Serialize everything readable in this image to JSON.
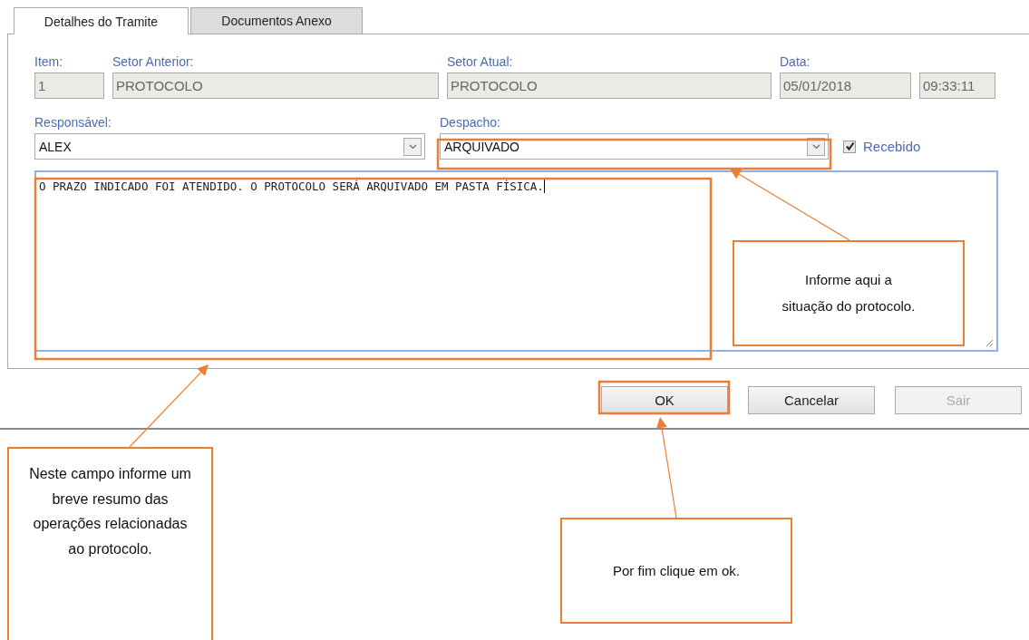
{
  "tabs": [
    {
      "label": "Detalhes do Tramite",
      "selected": true
    },
    {
      "label": "Documentos Anexo",
      "selected": false
    }
  ],
  "info_fields": [
    {
      "label": "Item:",
      "value": "1",
      "disabled": true
    },
    {
      "label": "Setor Anterior:",
      "value": "PROTOCOLO",
      "disabled": true
    },
    {
      "label": "Setor Atual:",
      "value": "PROTOCOLO",
      "disabled": true
    },
    {
      "label": "Data:",
      "value": "05/01/2018",
      "disabled": true
    },
    {
      "value": "09:33:11",
      "disabled": true
    }
  ],
  "responsavel": {
    "label": "Responsável:",
    "value": "ALEX"
  },
  "despacho": {
    "label": "Despacho:",
    "value": "ARQUIVADO"
  },
  "recebido": {
    "label": "Recebido",
    "checked": true
  },
  "resumo": {
    "value": "O PRAZO INDICADO FOI ATENDIDO. O PROTOCOLO SERÁ ARQUIVADO EM PASTA FÍSICA."
  },
  "buttons": [
    {
      "label": "OK",
      "disabled": false
    },
    {
      "label": "Cancelar",
      "disabled": false
    },
    {
      "label": "Sair",
      "disabled": true
    }
  ],
  "annotations": [
    {
      "text": "Informe aqui a situação do protocolo."
    },
    {
      "text": "Neste campo informe um breve resumo das operações relacionadas ao protocolo."
    },
    {
      "text": "Por fim clique em ok."
    }
  ]
}
